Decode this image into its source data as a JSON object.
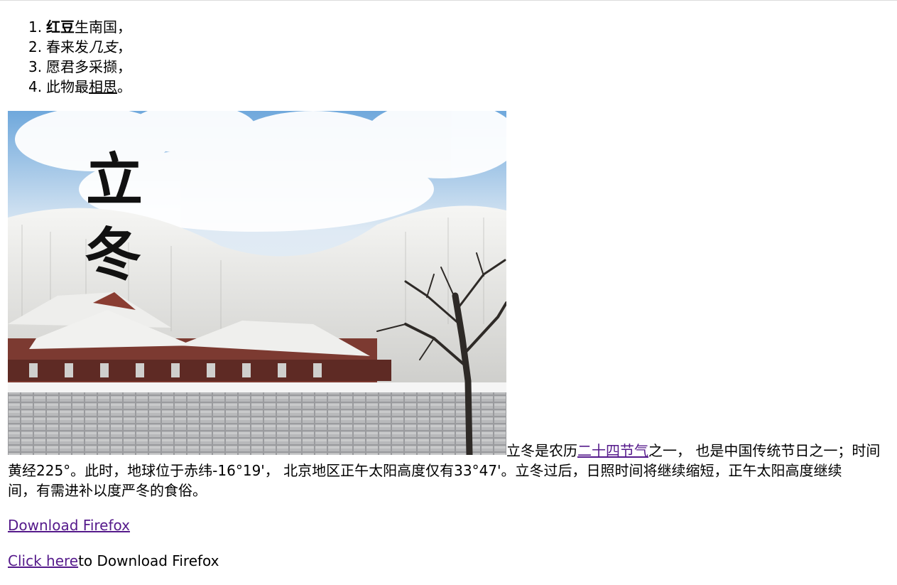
{
  "poem": [
    {
      "num": "1.",
      "bold": "红豆",
      "rest": "生南国，"
    },
    {
      "num": "2.",
      "pre": "春来发",
      "italic": "几支",
      "post": "，"
    },
    {
      "num": "3.",
      "text": "愿君多采撷，"
    },
    {
      "num": "4.",
      "pre": "此物最",
      "underline": "相思",
      "post": "。"
    }
  ],
  "image": {
    "caption_char_1": "立",
    "caption_char_2": "冬",
    "colors": {
      "sky": "#7fb3e0",
      "wall": "#8d8f93",
      "roof_trim": "#8a3d32"
    }
  },
  "paragraph": {
    "line1_pre": "立冬是农历",
    "line1_link": "二十四节气",
    "line1_post": "之一， 也是中国传统节日之一；时间",
    "line2": "黄经225°。此时，地球位于赤纬-16°19'， 北京地区正午太阳高度仅有33°47'。立冬过后，日照时间将继续缩短，正午太阳高度继续",
    "line3": "间，有需进补以度严冬的食俗。"
  },
  "links": {
    "download_firefox": "Download Firefox",
    "click_here": "Click here",
    "click_here_suffix": "to Download Firefox"
  }
}
